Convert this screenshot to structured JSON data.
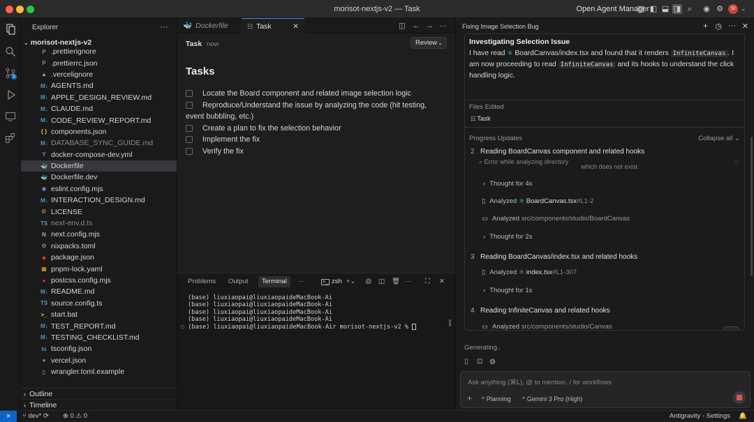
{
  "window": {
    "title": "morisot-nextjs-v2 — Task",
    "open_agent_manager": "Open Agent Manager"
  },
  "explorer": {
    "header": "Explorer",
    "project": "morisot-nextjs-v2",
    "files": [
      {
        "name": ".prettierignore",
        "icon": "P",
        "color": "#8a8a8a"
      },
      {
        "name": ".prettierrc.json",
        "icon": "P",
        "color": "#8a8a8a"
      },
      {
        "name": ".vercelignore",
        "icon": "▲",
        "color": "#9aa"
      },
      {
        "name": "AGENTS.md",
        "icon": "M↓",
        "color": "#519aba"
      },
      {
        "name": "APPLE_DESIGN_REVIEW.md",
        "icon": "M↓",
        "color": "#519aba"
      },
      {
        "name": "CLAUDE.md",
        "icon": "M↓",
        "color": "#519aba"
      },
      {
        "name": "CODE_REVIEW_REPORT.md",
        "icon": "M↓",
        "color": "#519aba"
      },
      {
        "name": "components.json",
        "icon": "{ }",
        "color": "#cbcb41"
      },
      {
        "name": "DATABASE_SYNC_GUIDE.md",
        "icon": "M↓",
        "color": "#519aba",
        "dim": true
      },
      {
        "name": "docker-compose-dev.yml",
        "icon": "Y",
        "color": "#a074c4"
      },
      {
        "name": "Dockerfile",
        "icon": "🐳",
        "color": "#2496ed",
        "selected": true
      },
      {
        "name": "Dockerfile.dev",
        "icon": "🐳",
        "color": "#2496ed"
      },
      {
        "name": "eslint.config.mjs",
        "icon": "◉",
        "color": "#8080f2"
      },
      {
        "name": "INTERACTION_DESIGN.md",
        "icon": "M↓",
        "color": "#519aba"
      },
      {
        "name": "LICENSE",
        "icon": "©",
        "color": "#cbcb41"
      },
      {
        "name": "next-env.d.ts",
        "icon": "TS",
        "color": "#519aba",
        "dim": true
      },
      {
        "name": "next.config.mjs",
        "icon": "N",
        "color": "#aaaaaa"
      },
      {
        "name": "nixpacks.toml",
        "icon": "⚙",
        "color": "#aaaaaa"
      },
      {
        "name": "package.json",
        "icon": "◆",
        "color": "#cb3837"
      },
      {
        "name": "pnpm-lock.yaml",
        "icon": "▦",
        "color": "#f9ad00"
      },
      {
        "name": "postcss.config.mjs",
        "icon": "●",
        "color": "#dd3a0a"
      },
      {
        "name": "README.md",
        "icon": "M↓",
        "color": "#519aba"
      },
      {
        "name": "source.config.ts",
        "icon": "TS",
        "color": "#519aba"
      },
      {
        "name": "start.bat",
        "icon": ">_",
        "color": "#c1f12e"
      },
      {
        "name": "TEST_REPORT.md",
        "icon": "M↓",
        "color": "#519aba"
      },
      {
        "name": "TESTING_CHECKLIST.md",
        "icon": "M↓",
        "color": "#519aba"
      },
      {
        "name": "tsconfig.json",
        "icon": "ts",
        "color": "#519aba"
      },
      {
        "name": "vercel.json",
        "icon": "●",
        "color": "#519aba"
      },
      {
        "name": "wrangler.toml.example",
        "icon": "▯",
        "color": "#aaaaaa"
      }
    ],
    "outline": "Outline",
    "timeline": "Timeline"
  },
  "editor": {
    "tabs": [
      {
        "label": "Dockerfile"
      },
      {
        "label": "Task"
      }
    ],
    "task_label": "Task",
    "task_time": "now",
    "review": "Review",
    "tasks_title": "Tasks",
    "tasks": [
      "Locate the Board component and related image selection logic",
      "Reproduce/Understand the issue by analyzing the code (hit testing, event bubbling, etc.)",
      "Create a plan to fix the selection behavior",
      "Implement the fix",
      "Verify the fix"
    ]
  },
  "panel": {
    "tabs": [
      "Problems",
      "Output",
      "Terminal"
    ],
    "shell": "zsh",
    "terminal_lines": [
      "(base) liuxiaopai@liuxiaopaideMacBook-Ai",
      "(base) liuxiaopai@liuxiaopaideMacBook-Ai",
      "(base) liuxiaopai@liuxiaopaideMacBook-Ai",
      "(base) liuxiaopai@liuxiaopaideMacBook-Ai",
      "(base) liuxiaopai@liuxiaopaideMacBook-Air morisot-nextjs-v2 % "
    ]
  },
  "agent": {
    "title": "Fixing Image Selection Bug",
    "heading": "Investigating Selection Issue",
    "msg_1": "I have read",
    "msg_file": "BoardCanvas/index.tsx",
    "msg_2": "and found that it renders",
    "msg_code1": "InfiniteCanvas",
    "msg_3": ". I am now proceeding to read",
    "msg_code2": "InfiniteCanvas",
    "msg_4": "and its hooks to understand the click handling logic.",
    "files_edited": "Files Edited",
    "file_task": "Task",
    "progress": "Progress Updates",
    "collapse": "Collapse all",
    "s2_num": "2",
    "s2_title": "Reading BoardCanvas component and related hooks",
    "s2_err": "Error while analyzing directory",
    "s2_err2": "which does not exist.",
    "thought1": "Thought for 4s",
    "analyzed": "Analyzed",
    "a1_file": "BoardCanvas.tsx",
    "a1_range": "#L1-2",
    "a2_path": "src/components/studio/BoardCanvas",
    "thought2": "Thought for 2s",
    "s3_num": "3",
    "s3_title": "Reading BoardCanvas/index.tsx and related hooks",
    "a3_file": "index.tsx",
    "a3_range": "#L1-307",
    "thought3": "Thought for 1s",
    "s4_num": "4",
    "s4_title": "Reading InfiniteCanvas and related hooks",
    "a4_path": "src/components/studio/Canvas",
    "generating": "Generating..",
    "input_placeholder": "Ask anything (⌘L), @ to mention, / for workflows",
    "mode": "Planning",
    "model": "Gemini 3 Pro (High)"
  },
  "status": {
    "branch": "dev*",
    "errors": "0",
    "warnings": "0",
    "right": "Antigravity - Settings"
  }
}
